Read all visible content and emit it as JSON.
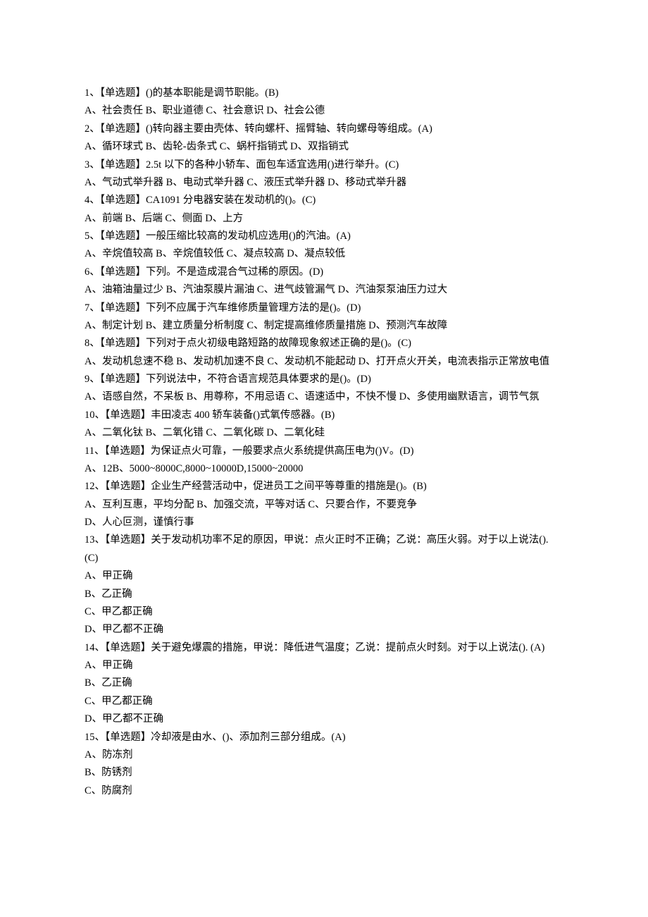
{
  "lines": [
    "1、【单选题】()的基本职能是调节职能。(B)",
    "A、社会责任 B、职业道德 C、社会意识 D、社会公德",
    "2、【单选题】()转向器主要由壳体、转向螺杆、摇臂轴、转向螺母等组成。(A)",
    "A、循环球式 B、齿轮-齿条式 C、蜗杆指销式 D、双指销式",
    "3、【单选题】2.5t 以下的各种小轿车、面包车适宜选用()进行举升。(C)",
    "A、气动式举升器 B、电动式举升器 C、液压式举升器 D、移动式举升器",
    "4、【单选题】CA1091 分电器安装在发动机的()。(C)",
    "A、前端 B、后端 C、侧面 D、上方",
    "5、【单选题】一般压缩比较高的发动机应选用()的汽油。(A)",
    "A、辛烷值较高 B、辛烷值较低 C、凝点较高 D、凝点较低",
    "6、【单选题】下列。不是造成混合气过稀的原因。(D)",
    "A、油箱油量过少 B、汽油泵膜片漏油 C、进气歧管漏气 D、汽油泵泵油压力过大",
    "7、【单选题】下列不应属于汽车维修质量管理方法的是()。(D)",
    "A、制定计划 B、建立质量分析制度 C、制定提高维修质量措施 D、预测汽车故障",
    "8、【单选题】下列对于点火初级电路短路的故障现象叙述正确的是()。(C)",
    "A、发动机怠速不稳 B、发动机加速不良 C、发动机不能起动 D、打开点火开关，电流表指示正常放电值",
    "9、【单选题】下列说法中，不符合语言规范具体要求的是()。(D)",
    "A、语感自然，不呆板 B、用尊称，不用忌语 C、语速适中，不快不慢 D、多使用幽默语言，调节气氛",
    "10、【单选题】丰田凌志 400 轿车装备()式氧传感器。(B)",
    "A、二氧化钛 B、二氧化错 C、二氧化碳 D、二氧化硅",
    "11、【单选题】为保证点火可靠，一般要求点火系统提供高压电为()V。(D)",
    "A、12B、5000~8000C,8000~10000D,15000~20000",
    "12、【单选题】企业生产经营活动中，促进员工之间平等尊重的措施是()。(B)",
    "A、互利互惠，平均分配 B、加强交流，平等对话 C、只要合作，不要竞争",
    "D、人心叵测，谨慎行事",
    "13、【单选题】关于发动机功率不足的原因，甲说：点火正时不正确；乙说：高压火弱。对于以上说法(). (C)",
    "A、甲正确",
    "B、乙正确",
    "C、甲乙都正确",
    "D、甲乙都不正确",
    "14、【单选题】关于避免爆震的措施，甲说：降低进气温度；乙说：提前点火时刻。对于以上说法(). (A)",
    "A、甲正确",
    "B、乙正确",
    "C、甲乙都正确",
    "D、甲乙都不正确",
    "15、【单选题】冷却液是由水、()、添加剂三部分组成。(A)",
    "A、防冻剂",
    "B、防锈剂",
    "C、防腐剂"
  ]
}
